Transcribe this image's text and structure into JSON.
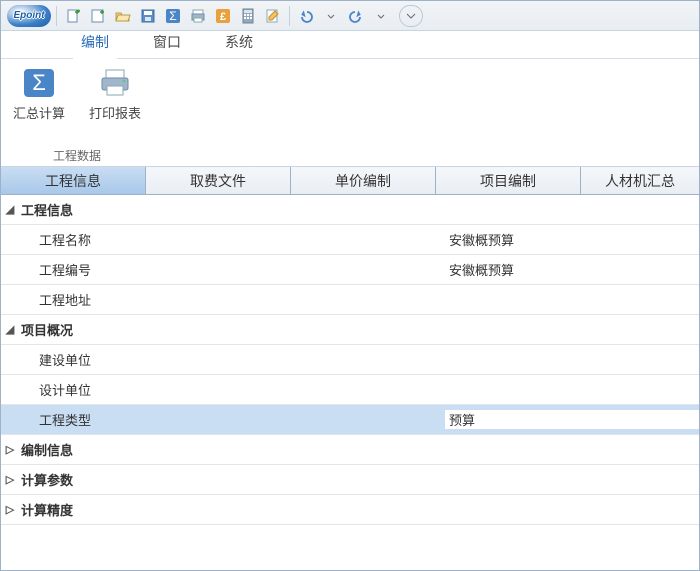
{
  "logo_text": "Epoint",
  "menu": {
    "tabs": [
      "编制",
      "窗口",
      "系统"
    ],
    "active": 0
  },
  "ribbon": {
    "buttons": [
      {
        "label": "汇总计算"
      },
      {
        "label": "打印报表"
      }
    ],
    "group_title": "工程数据"
  },
  "subtabs": {
    "items": [
      "工程信息",
      "取费文件",
      "单价编制",
      "项目编制",
      "人材机汇总"
    ],
    "active": 0
  },
  "tree": {
    "groups": [
      {
        "label": "工程信息",
        "expanded": true,
        "items": [
          {
            "label": "工程名称",
            "value": "安徽概预算"
          },
          {
            "label": "工程编号",
            "value": "安徽概预算"
          },
          {
            "label": "工程地址",
            "value": ""
          }
        ]
      },
      {
        "label": "项目概况",
        "expanded": true,
        "items": [
          {
            "label": "建设单位",
            "value": ""
          },
          {
            "label": "设计单位",
            "value": ""
          },
          {
            "label": "工程类型",
            "value": "预算",
            "selected": true
          }
        ]
      },
      {
        "label": "编制信息",
        "expanded": false,
        "items": []
      },
      {
        "label": "计算参数",
        "expanded": false,
        "items": []
      },
      {
        "label": "计算精度",
        "expanded": false,
        "items": []
      }
    ]
  }
}
